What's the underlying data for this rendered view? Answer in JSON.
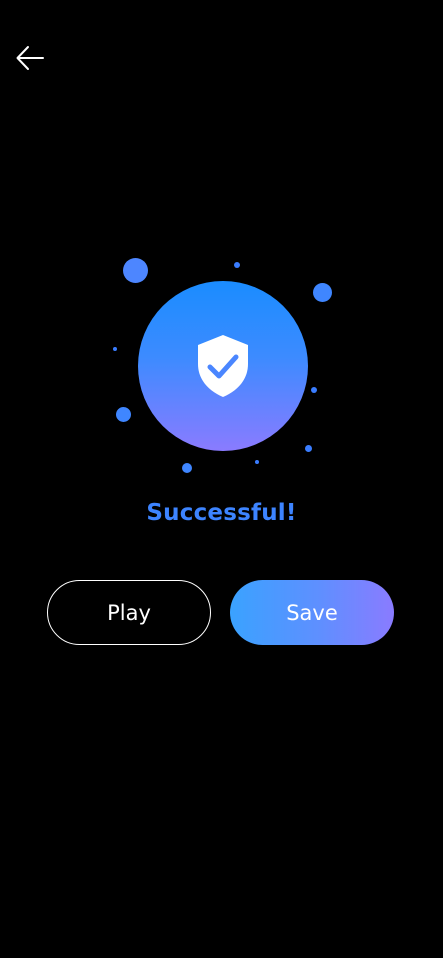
{
  "header": {
    "back_icon": "arrow-left-icon"
  },
  "hero": {
    "icon": "shield-check-icon",
    "status_text": "Successful!",
    "colors": {
      "accent": "#3d84ff",
      "gradient_top": "#1a8cff",
      "gradient_bottom": "#8a7bff"
    }
  },
  "actions": {
    "play_label": "Play",
    "save_label": "Save"
  }
}
